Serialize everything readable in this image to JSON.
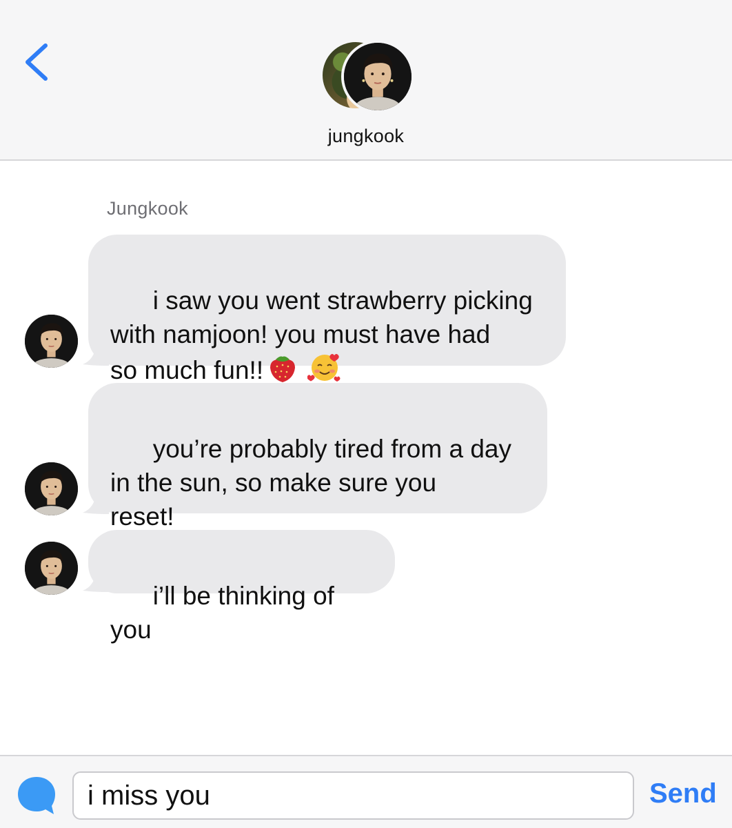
{
  "header": {
    "contact_name": "jungkook"
  },
  "conversation": {
    "sender_label": "Jungkook",
    "messages": [
      {
        "text": "i saw you went strawberry picking\nwith namjoon! you must have had\nso much fun!!",
        "emojis": [
          "strawberry-emoji",
          "smiling-face-with-hearts-emoji"
        ]
      },
      {
        "text": "you’re probably tired from a day\nin the sun, so make sure you\nreset!"
      },
      {
        "text": "i’ll be thinking of you"
      }
    ]
  },
  "composer": {
    "input_value": "i miss you",
    "send_label": "Send"
  },
  "colors": {
    "accent": "#2f7df6",
    "bubble_incoming": "#e9e9eb",
    "header_bg": "#f6f6f7"
  }
}
